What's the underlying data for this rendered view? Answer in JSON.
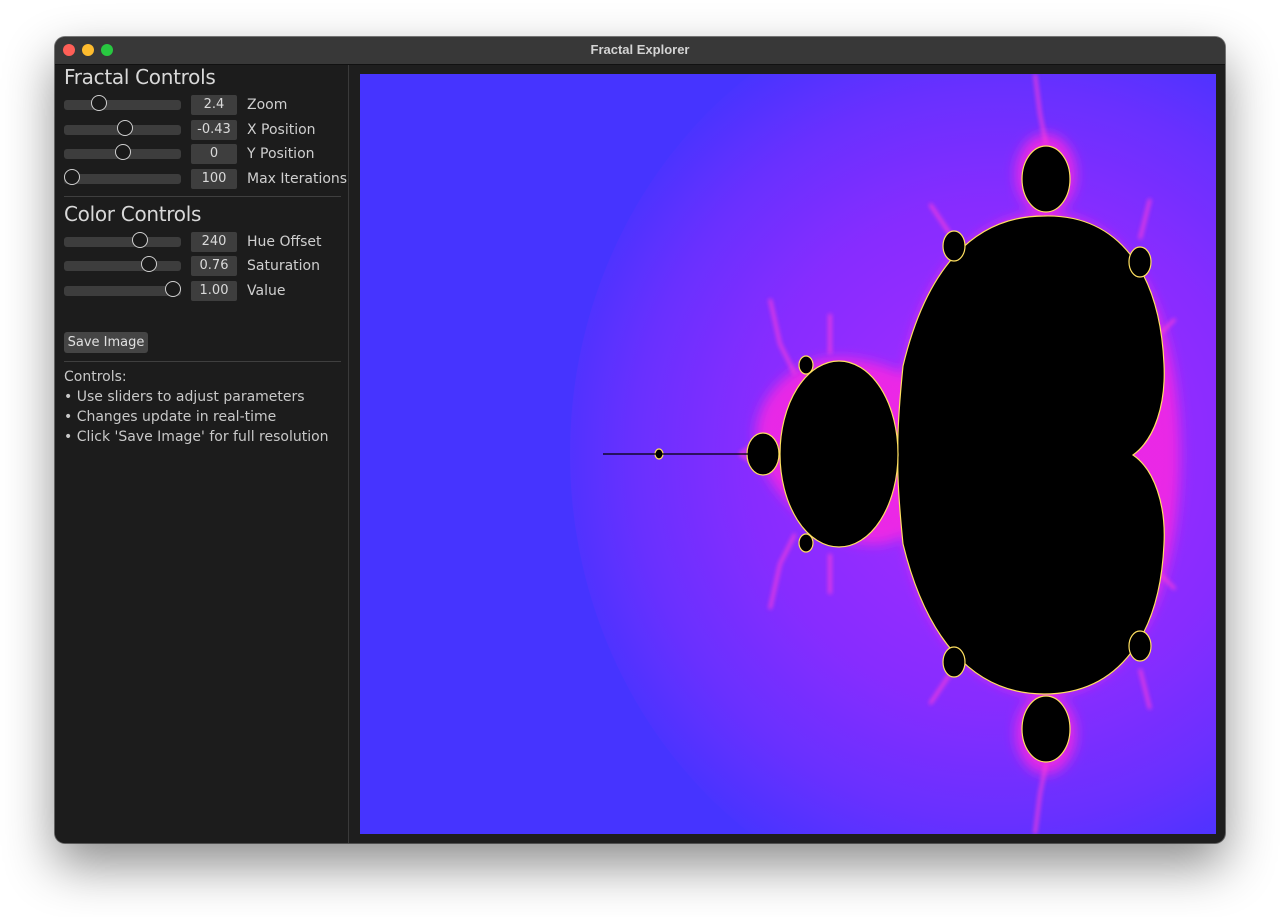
{
  "window": {
    "title": "Fractal Explorer"
  },
  "fractal_controls": {
    "title": "Fractal Controls",
    "sliders": [
      {
        "label": "Zoom",
        "display": "2.4",
        "fraction": 0.27
      },
      {
        "label": "X Position",
        "display": "-0.43",
        "fraction": 0.52
      },
      {
        "label": "Y Position",
        "display": "0",
        "fraction": 0.5
      },
      {
        "label": "Max Iterations",
        "display": "100",
        "fraction": 0.0
      }
    ]
  },
  "color_controls": {
    "title": "Color Controls",
    "sliders": [
      {
        "label": "Hue Offset",
        "display": "240",
        "fraction": 0.67
      },
      {
        "label": "Saturation",
        "display": "0.76",
        "fraction": 0.76
      },
      {
        "label": "Value",
        "display": "1.00",
        "fraction": 1.0
      }
    ]
  },
  "save_button": {
    "label": "Save Image"
  },
  "help": {
    "heading": "Controls:",
    "lines": [
      "• Use sliders to adjust parameters",
      "• Changes update in real-time",
      "• Click 'Save Image' for full resolution"
    ]
  },
  "colors": {
    "background_blue": "#4634ff",
    "halo_purple": "#8a2cff",
    "edge_magenta": "#ff28e0",
    "set_black": "#000000"
  }
}
